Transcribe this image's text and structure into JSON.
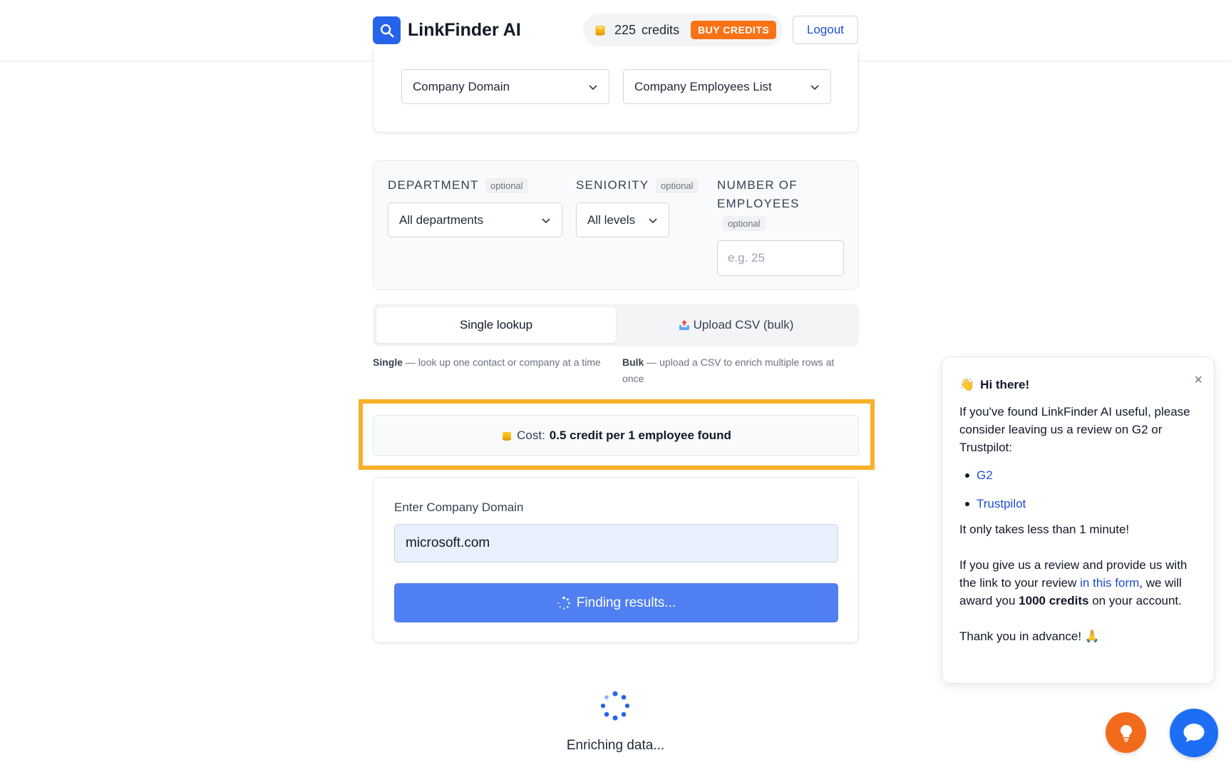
{
  "header": {
    "app_name": "LinkFinder AI",
    "logo_icon": "search-icon",
    "credits_count": "225",
    "credits_word": "credits",
    "buy_credits_label": "BUY CREDITS",
    "logout_label": "Logout"
  },
  "lookup_type": {
    "source_select": "Company Domain",
    "target_select": "Company Employees List"
  },
  "filters": {
    "department_label": "DEPARTMENT",
    "department_optional": "optional",
    "department_value": "All departments",
    "seniority_label": "SENIORITY",
    "seniority_optional": "optional",
    "seniority_value": "All levels",
    "employees_label_line1": "NUMBER OF",
    "employees_label_line2": "EMPLOYEES",
    "employees_optional": "optional",
    "employees_placeholder": "e.g. 25"
  },
  "mode_tabs": {
    "single_label": "Single lookup",
    "bulk_label": "Upload CSV (bulk)",
    "single_hint_bold": "Single",
    "single_hint": " — look up one contact or company at a time",
    "bulk_hint_bold": "Bulk",
    "bulk_hint": " — upload a CSV to enrich multiple rows at once"
  },
  "cost": {
    "prefix": "Cost:",
    "value": "0.5 credit per 1 employee found"
  },
  "input_card": {
    "label": "Enter Company Domain",
    "domain_value": "microsoft.com",
    "button_label": "Finding results..."
  },
  "status": {
    "enriching_text": "Enriching data..."
  },
  "popup": {
    "title": "Hi there!",
    "title_emoji": "👋",
    "close_symbol": "×",
    "intro": "If you've found LinkFinder AI useful, please consider leaving us a review on G2 or Trustpilot:",
    "links": [
      "G2",
      "Trustpilot"
    ],
    "time_note": "It only takes less than 1 minute!",
    "award_part1": "If you give us a review and provide us with the link to your review ",
    "award_link": "in this form",
    "award_part2": ", we will award you ",
    "award_bold": "1000 credits",
    "award_part3": " on your account.",
    "thanks": "Thank you in advance! 🙏"
  },
  "colors": {
    "brand_blue": "#2563eb",
    "buy_orange": "#f97316",
    "highlight": "#f8b028",
    "button_blue": "#4f7ff0"
  }
}
